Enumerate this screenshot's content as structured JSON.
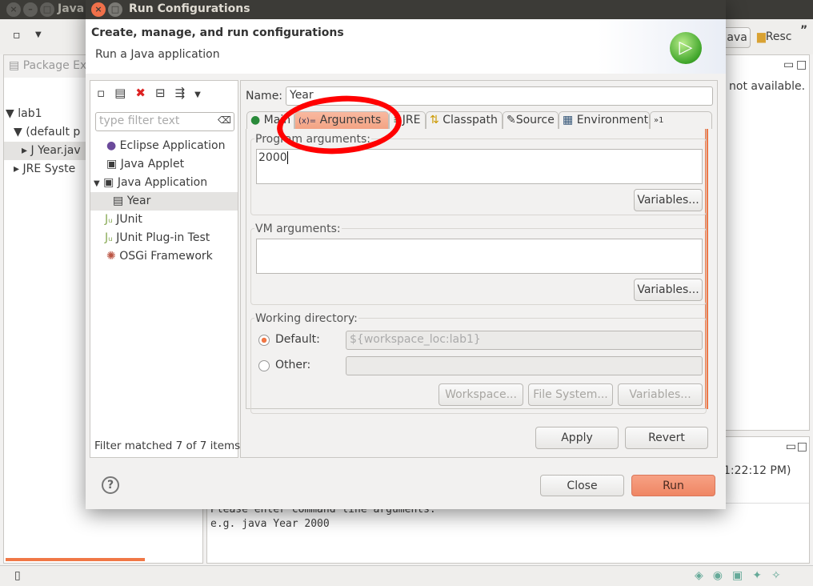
{
  "background": {
    "window_title": "Java",
    "perspective_java": "Java",
    "perspective_resource": "Resc",
    "overflow": "”",
    "package_explorer_tab": "Package Exp",
    "tree": [
      "lab1",
      "(default p",
      "Year.jav",
      "JRE Syste"
    ],
    "side_message": "not available.",
    "console_time": "1:22:12 PM)",
    "console_lines": [
      "Please enter command line arguments.",
      "e.g. java Year 2000"
    ]
  },
  "dialog": {
    "title": "Run Configurations",
    "header_title": "Create, manage, and run configurations",
    "header_subtitle": "Run a Java application",
    "filter_placeholder": "type filter text",
    "config_tree": [
      "Eclipse Application",
      "Java Applet",
      "Java Application",
      "Year",
      "JUnit",
      "JUnit Plug-in Test",
      "OSGi Framework"
    ],
    "filter_status": "Filter matched 7 of 7 items",
    "name_label": "Name:",
    "name_value": "Year",
    "tabs": [
      "Main",
      "Arguments",
      "JRE",
      "Classpath",
      "Source",
      "Environment",
      "»1"
    ],
    "active_tab": "Arguments",
    "program_args_label": "Program arguments:",
    "program_args_value": "2000",
    "vm_args_label": "VM arguments:",
    "vm_args_value": "",
    "variables_label": "Variables...",
    "working_dir_label": "Working directory:",
    "default_label": "Default:",
    "default_value": "${workspace_loc:lab1}",
    "default_selected": true,
    "other_label": "Other:",
    "other_value": "",
    "workspace_btn": "Workspace...",
    "filesystem_btn": "File System...",
    "apply": "Apply",
    "revert": "Revert",
    "close": "Close",
    "run": "Run",
    "accent": "#f07746",
    "annotation_color": "#ff0000"
  }
}
